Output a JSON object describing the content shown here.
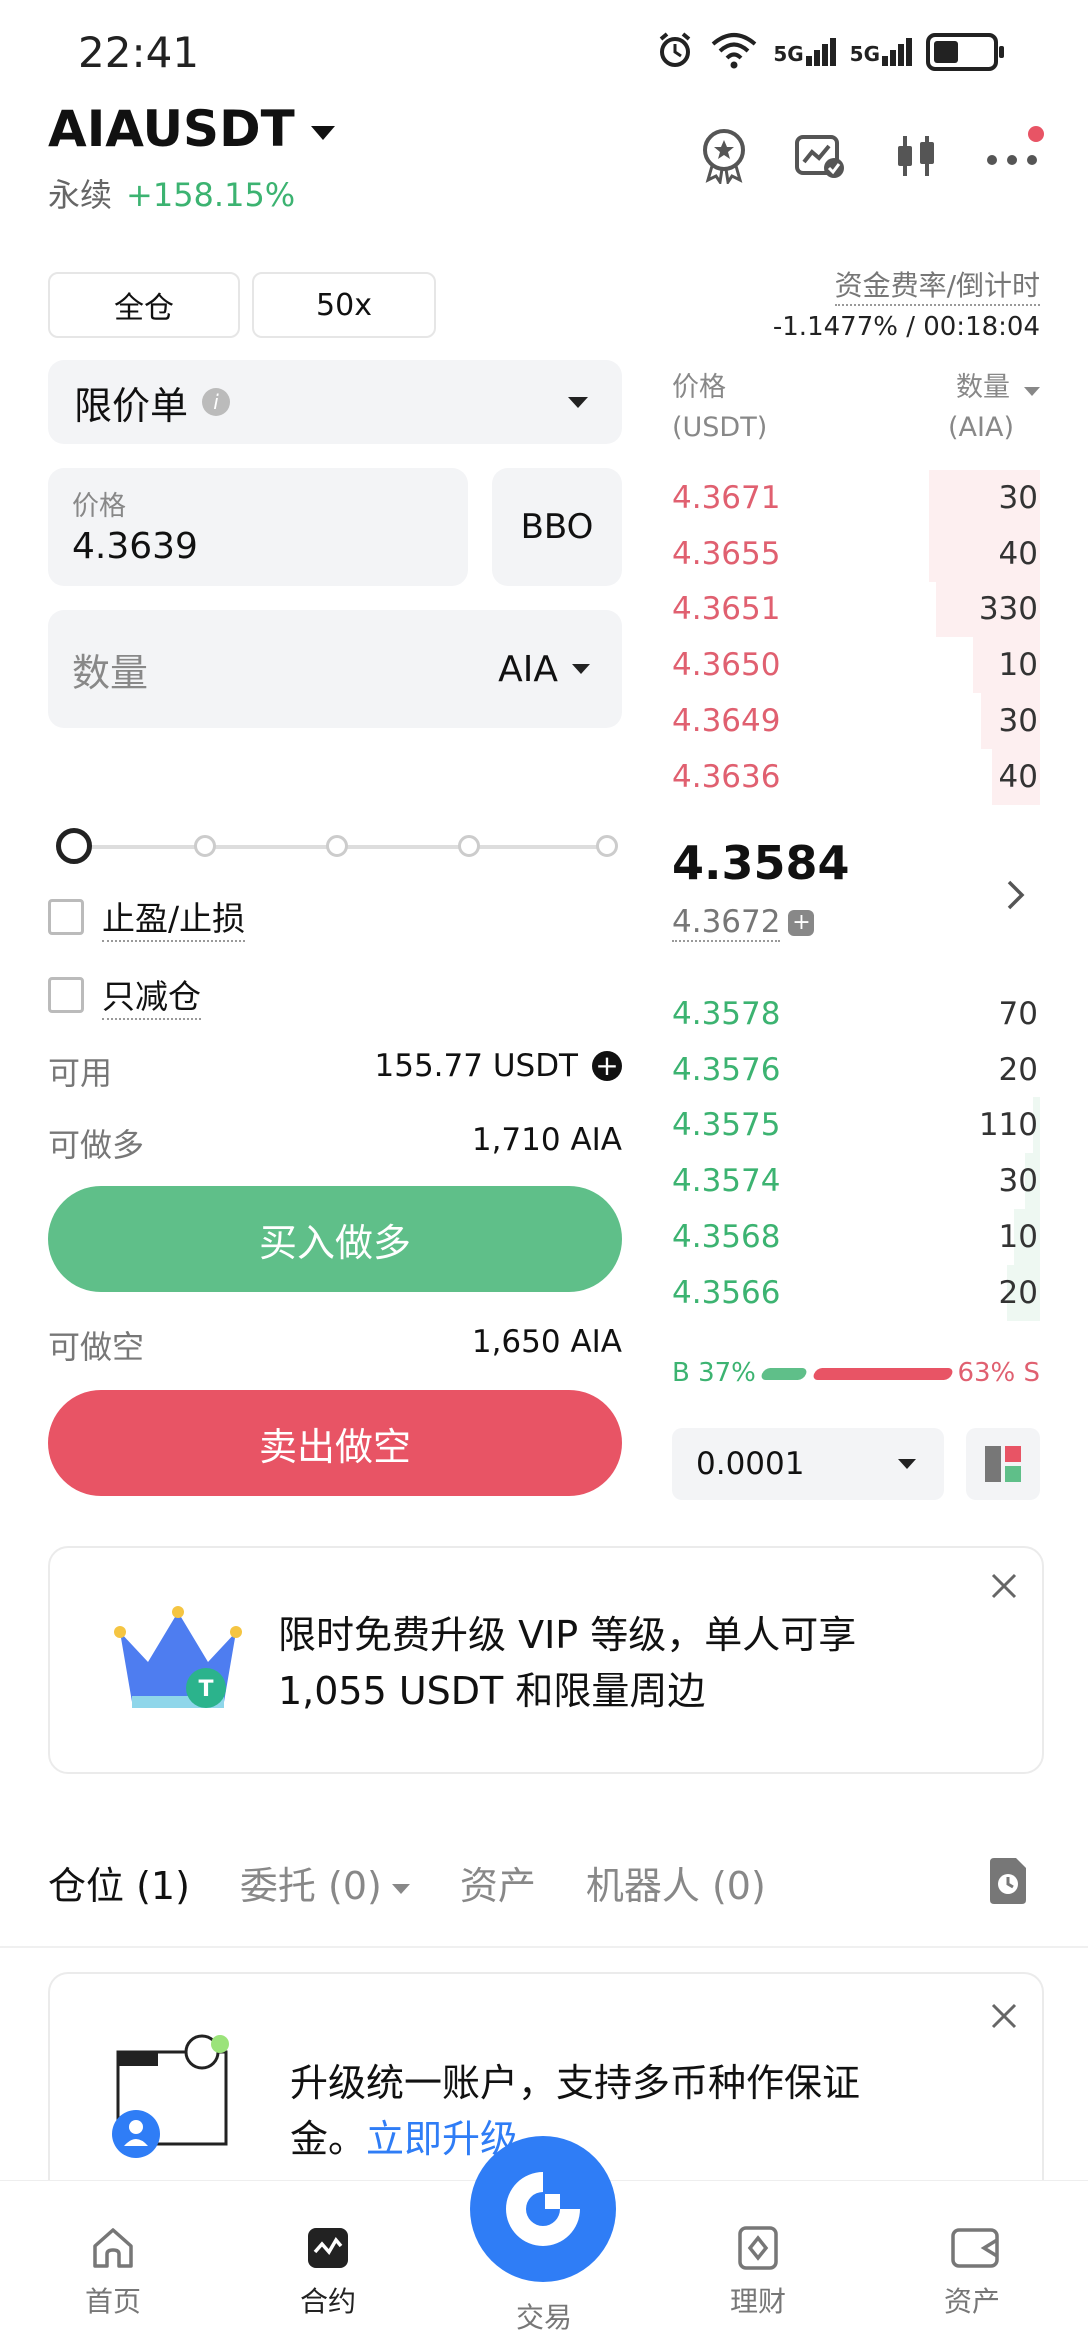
{
  "status_bar": {
    "time": "22:41",
    "network1": "5G",
    "network2": "5G",
    "wifi_badge": "6"
  },
  "header": {
    "pair": "AIAUSDT",
    "type": "永续",
    "change": "+158.15%"
  },
  "funding": {
    "label": "资金费率/倒计时",
    "value": "-1.1477% / 00:18:04"
  },
  "margin": {
    "mode": "全仓",
    "leverage": "50x"
  },
  "order_type": {
    "label": "限价单"
  },
  "price_input": {
    "label": "价格",
    "value": "4.3639",
    "bbo_label": "BBO"
  },
  "quantity_input": {
    "placeholder": "数量",
    "unit": "AIA"
  },
  "options": {
    "tpsl": "止盈/止损",
    "reduce_only": "只减仓"
  },
  "available": {
    "label": "可用",
    "value": "155.77 USDT"
  },
  "can_long": {
    "label": "可做多",
    "value": "1,710 AIA"
  },
  "can_short": {
    "label": "可做空",
    "value": "1,650 AIA"
  },
  "buy_button": "买入做多",
  "sell_button": "卖出做空",
  "orderbook": {
    "price_header": "价格",
    "price_unit": "(USDT)",
    "qty_header": "数量",
    "qty_unit": "(AIA)",
    "asks": [
      {
        "price": "4.3671",
        "qty": "30",
        "depth": 0.3
      },
      {
        "price": "4.3655",
        "qty": "40",
        "depth": 0.3
      },
      {
        "price": "4.3651",
        "qty": "330",
        "depth": 0.28
      },
      {
        "price": "4.3650",
        "qty": "10",
        "depth": 0.18
      },
      {
        "price": "4.3649",
        "qty": "30",
        "depth": 0.16
      },
      {
        "price": "4.3636",
        "qty": "40",
        "depth": 0.13
      }
    ],
    "last_price": "4.3584",
    "mark_price": "4.3672",
    "bids": [
      {
        "price": "4.3578",
        "qty": "70",
        "depth": 0.0
      },
      {
        "price": "4.3576",
        "qty": "20",
        "depth": 0.0
      },
      {
        "price": "4.3575",
        "qty": "110",
        "depth": 0.02
      },
      {
        "price": "4.3574",
        "qty": "30",
        "depth": 0.04
      },
      {
        "price": "4.3568",
        "qty": "10",
        "depth": 0.07
      },
      {
        "price": "4.3566",
        "qty": "20",
        "depth": 0.09
      }
    ],
    "buy_ratio_label": "B 37%",
    "sell_ratio_label": "63% S",
    "buy_ratio": 0.37,
    "precision": "0.0001"
  },
  "banner_vip": {
    "text_line1": "限时免费升级 VIP 等级，单人可享",
    "text_line2": "1,055 USDT 和限量周边"
  },
  "tabs": {
    "positions": "仓位 (1)",
    "orders": "委托 (0)",
    "assets": "资产",
    "bots": "机器人 (0)"
  },
  "banner_unified": {
    "text_line1": "升级统一账户，支持多币种作保证",
    "text_line2_prefix": "金。",
    "link": "立即升级"
  },
  "bottom_nav": {
    "home": "首页",
    "futures": "合约",
    "trade": "交易",
    "earn": "理财",
    "assets": "资产"
  },
  "colors": {
    "green": "#5fbf89",
    "red": "#e85465",
    "blue": "#2f7df6"
  }
}
